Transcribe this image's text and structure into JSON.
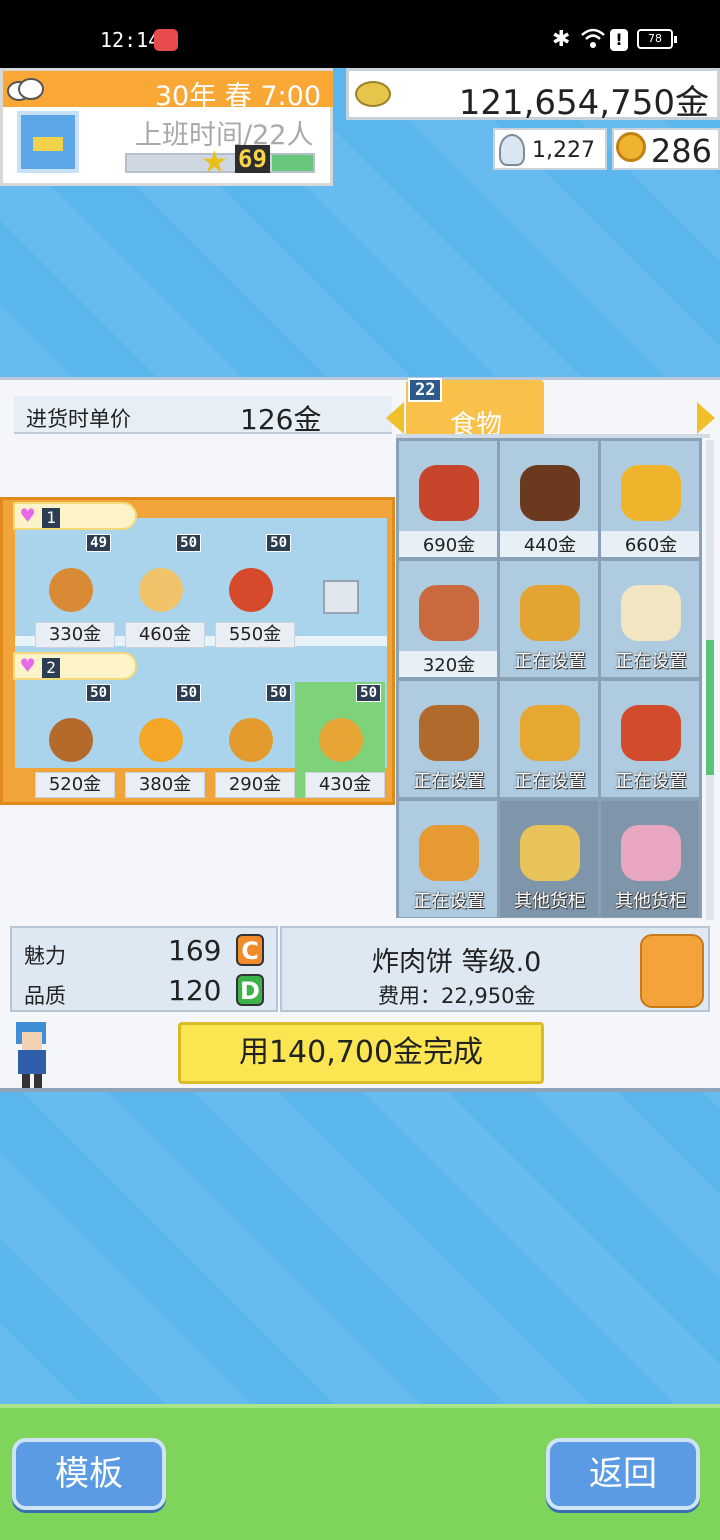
{
  "status_bar": {
    "time": "12:14",
    "battery": "78"
  },
  "header": {
    "date": "30年 春 7:00",
    "shift_info": "上班时间/22人",
    "level": "69",
    "level_fill_fraction": 0.22,
    "money": "121,654,750金",
    "research_points": "1,227",
    "medals": "286"
  },
  "dialog": {
    "unit_price_label": "进货时单价",
    "unit_price_value": "126金",
    "category_badge": "22",
    "category_name": "食物",
    "shelves": [
      {
        "row_tag": "1",
        "slots": [
          {
            "stock": "49",
            "price": "330金",
            "color": "#d98a34"
          },
          {
            "stock": "50",
            "price": "460金",
            "color": "#f0c36a"
          },
          {
            "stock": "50",
            "price": "550金",
            "color": "#d6492a"
          },
          {
            "stock": "",
            "price": "",
            "color": ""
          }
        ]
      },
      {
        "row_tag": "2",
        "slots": [
          {
            "stock": "50",
            "price": "520金",
            "color": "#b46a2a"
          },
          {
            "stock": "50",
            "price": "380金",
            "color": "#f4a627"
          },
          {
            "stock": "50",
            "price": "290金",
            "color": "#e39a2c"
          },
          {
            "stock": "50",
            "price": "430金",
            "color": "#e6a535"
          }
        ]
      }
    ],
    "goods": [
      {
        "label": "690金",
        "color": "#c7452a",
        "priced": true
      },
      {
        "label": "440金",
        "color": "#6b3a1e",
        "priced": true
      },
      {
        "label": "660金",
        "color": "#f0b42c",
        "priced": true
      },
      {
        "label": "320金",
        "color": "#c96a3e",
        "priced": true
      },
      {
        "label": "正在设置",
        "color": "#e4a431",
        "priced": false
      },
      {
        "label": "正在设置",
        "color": "#f2e6c2",
        "priced": false
      },
      {
        "label": "正在设置",
        "color": "#b06a2c",
        "priced": false
      },
      {
        "label": "正在设置",
        "color": "#e6a830",
        "priced": false
      },
      {
        "label": "正在设置",
        "color": "#d24b2c",
        "priced": false
      },
      {
        "label": "正在设置",
        "color": "#e59a34",
        "priced": false
      },
      {
        "label": "其他货柜",
        "color": "#e7c35a",
        "priced": false
      },
      {
        "label": "其他货柜",
        "color": "#e8a6c0",
        "priced": false
      }
    ],
    "stats": {
      "charm_label": "魅力",
      "charm_value": "169",
      "charm_grade": "C",
      "quality_label": "品质",
      "quality_value": "120",
      "quality_grade": "D"
    },
    "item_name": "炸肉饼 等级.0",
    "item_cost": "费用：22,950金",
    "complete_button": "用140,700金完成"
  },
  "bottom": {
    "template_button": "模板",
    "back_button": "返回"
  },
  "colors": {
    "accent": "#f9a836",
    "panel": "#f4f6fa",
    "bottom_bar": "#7fd45c",
    "button": "#5a9be3"
  }
}
